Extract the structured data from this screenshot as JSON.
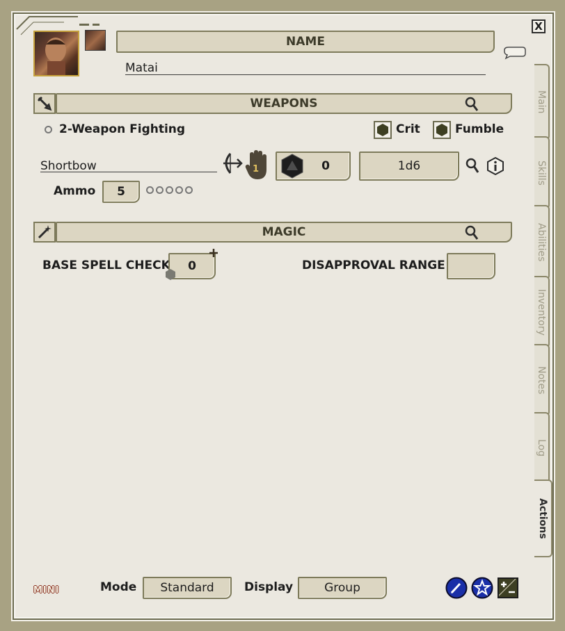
{
  "window": {
    "close_label": "X"
  },
  "name": {
    "header": "NAME",
    "value": "Matai"
  },
  "weapons": {
    "header": "WEAPONS",
    "two_weapon_label": "2-Weapon Fighting",
    "crit_label": "Crit",
    "fumble_label": "Fumble",
    "item": {
      "name": "Shortbow",
      "hand_count": "1",
      "attack_bonus": "0",
      "damage": "1d6",
      "ammo_label": "Ammo",
      "ammo_value": "5",
      "ammo_pips": 5
    }
  },
  "magic": {
    "header": "MAGIC",
    "base_spell_check_label": "BASE SPELL CHECK",
    "base_spell_check_value": "0",
    "disapproval_label": "DISAPPROVAL RANGE",
    "disapproval_value": ""
  },
  "tabs": [
    {
      "label": "Main",
      "active": false
    },
    {
      "label": "Skills",
      "active": false
    },
    {
      "label": "Abilities",
      "active": false
    },
    {
      "label": "Inventory",
      "active": false
    },
    {
      "label": "Notes",
      "active": false
    },
    {
      "label": "Log",
      "active": false
    },
    {
      "label": "Actions",
      "active": true
    }
  ],
  "footer": {
    "mini_label": "MINI",
    "mode_label": "Mode",
    "mode_value": "Standard",
    "display_label": "Display",
    "display_value": "Group"
  },
  "icons": {
    "portrait": "character-portrait",
    "token": "character-token",
    "chat": "chat-bubble-icon",
    "weapons": "sword-icon",
    "magic": "wand-icon",
    "search": "magnifier-icon",
    "dice": "d20-icon",
    "info": "info-icon",
    "ranged": "bow-arrow-icon",
    "hand": "hand-icon"
  },
  "colors": {
    "background": "#a8a283",
    "panel": "#ebe8e0",
    "field": "#dcd6c2",
    "border": "#7d7a5a",
    "hex": "#4a4a2a",
    "mode_blue": "#1a2fa8"
  }
}
